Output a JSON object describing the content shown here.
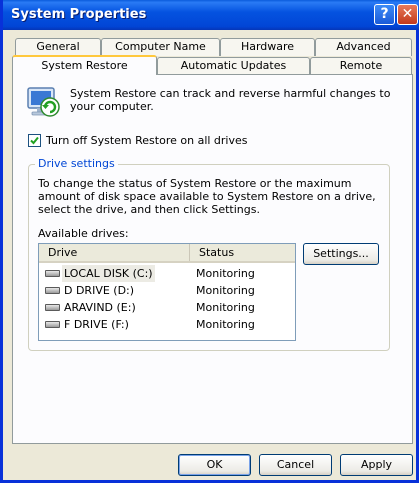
{
  "window": {
    "title": "System Properties",
    "help_glyph": "?",
    "close_glyph": "✕"
  },
  "tabs": {
    "row1": [
      "General",
      "Computer Name",
      "Hardware",
      "Advanced"
    ],
    "row2": [
      "System Restore",
      "Automatic Updates",
      "Remote"
    ],
    "active": "System Restore"
  },
  "system_restore": {
    "intro_icon": "system-restore-icon",
    "intro_text": "System Restore can track and reverse harmful changes to your computer.",
    "turn_off_label": "Turn off System Restore on all drives",
    "turn_off_checked": true,
    "drive_settings": {
      "group_label": "Drive settings",
      "description": "To change the status of System Restore or the maximum amount of disk space available to System Restore on a drive, select the drive, and then click Settings.",
      "available_label": "Available drives:",
      "columns": [
        "Drive",
        "Status"
      ],
      "drives": [
        {
          "name": "LOCAL DISK (C:)",
          "status": "Monitoring"
        },
        {
          "name": "D DRIVE (D:)",
          "status": "Monitoring"
        },
        {
          "name": "ARAVIND (E:)",
          "status": "Monitoring"
        },
        {
          "name": "F DRIVE (F:)",
          "status": "Monitoring"
        }
      ],
      "selected_drive": "LOCAL DISK (C:)",
      "settings_button": "Settings..."
    }
  },
  "buttons": {
    "ok": "OK",
    "cancel": "Cancel",
    "apply": "Apply"
  },
  "colors": {
    "titlebar": "#0553e0",
    "active_tab_accent": "#ffc83c",
    "group_label": "#0046d5",
    "dialog_bg": "#ece9d8"
  }
}
